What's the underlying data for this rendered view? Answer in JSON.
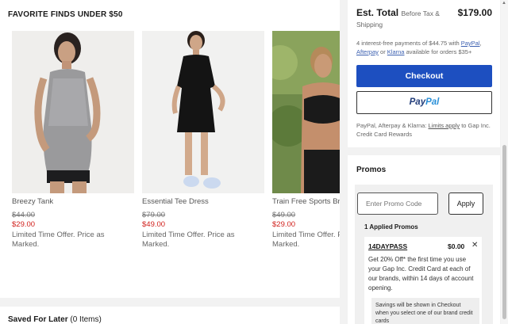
{
  "finds": {
    "title": "FAVORITE FINDS UNDER $50",
    "products": [
      {
        "name": "Breezy Tank",
        "old_price": "$44.00",
        "new_price": "$29.00",
        "offer": "Limited Time Offer. Price as Marked."
      },
      {
        "name": "Essential Tee Dress",
        "old_price": "$79.00",
        "new_price": "$49.00",
        "offer": "Limited Time Offer. Price as Marked."
      },
      {
        "name": "Train Free Sports Bra",
        "old_price": "$49.00",
        "new_price": "$29.00",
        "offer": "Limited Time Offer. Price as Marked."
      }
    ]
  },
  "saved": {
    "title": "Saved For Later",
    "count": "(0 Items)"
  },
  "summary": {
    "est_total_label": "Est. Total",
    "est_total_note": "Before Tax &",
    "shipping_note": "Shipping",
    "total": "$179.00",
    "installments_text": "4 interest-free payments of $44.75 with",
    "paypal_link": "PayPal",
    "afterpay_link": "Afterpay",
    "or_text": "or",
    "klarna_link": "Klarna",
    "installments_tail": "available for orders $35+",
    "checkout_label": "Checkout",
    "paypal_pay": "Pay",
    "paypal_pal": "Pal",
    "paypal_note_pre": "PayPal, Afterpay & Klarna:",
    "paypal_note_link": "Limits apply",
    "paypal_note_post": "to Gap Inc. Credit Card Rewards"
  },
  "promos": {
    "title": "Promos",
    "input_placeholder": "Enter Promo Code",
    "apply_label": "Apply",
    "applied_label": "1 Applied Promos",
    "applied": {
      "code": "14DAYPASS",
      "amount": "$0.00",
      "description": "Get 20% Off* the first time you use your Gap Inc. Credit Card at each of our brands, within 14 days of account opening.",
      "sub_note": "Savings will be shown in Checkout when you select one of our brand credit cards"
    }
  },
  "colors": {
    "accent": "#1d4fc0",
    "sale": "#d0201c",
    "paypal_dark": "#223d7a",
    "paypal_light": "#2a90d8"
  }
}
